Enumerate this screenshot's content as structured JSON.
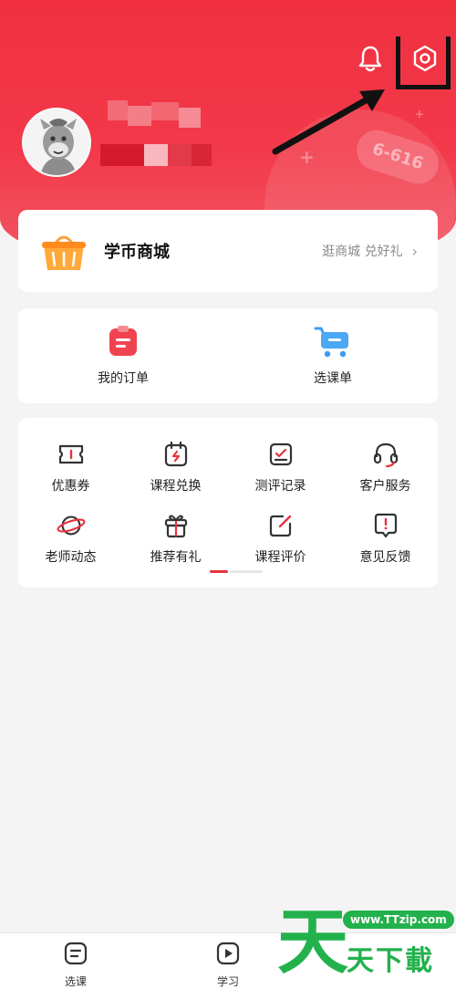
{
  "header": {
    "deco_tag": "6-616"
  },
  "store": {
    "title": "学币商城",
    "subtitle": "逛商城 兑好礼",
    "chevron": "›"
  },
  "orders": [
    {
      "label": "我的订单",
      "icon": "order-clipboard-icon"
    },
    {
      "label": "选课单",
      "icon": "shopping-cart-icon"
    }
  ],
  "services": [
    {
      "label": "优惠券",
      "icon": "coupon-icon"
    },
    {
      "label": "课程兑换",
      "icon": "course-exchange-icon"
    },
    {
      "label": "测评记录",
      "icon": "assessment-record-icon"
    },
    {
      "label": "客户服务",
      "icon": "headset-icon"
    },
    {
      "label": "老师动态",
      "icon": "planet-icon"
    },
    {
      "label": "推荐有礼",
      "icon": "gift-icon"
    },
    {
      "label": "课程评价",
      "icon": "edit-review-icon"
    },
    {
      "label": "意见反馈",
      "icon": "feedback-icon"
    }
  ],
  "tabbar": {
    "tabs": [
      {
        "label": "选课",
        "icon": "course-select-icon"
      },
      {
        "label": "学习",
        "icon": "play-study-icon"
      }
    ]
  },
  "watermark": {
    "big": "天",
    "url": "www.TTzip.com",
    "text": "天下載"
  },
  "colors": {
    "brand_red": "#f0303f",
    "accent_green": "#22b14c"
  }
}
